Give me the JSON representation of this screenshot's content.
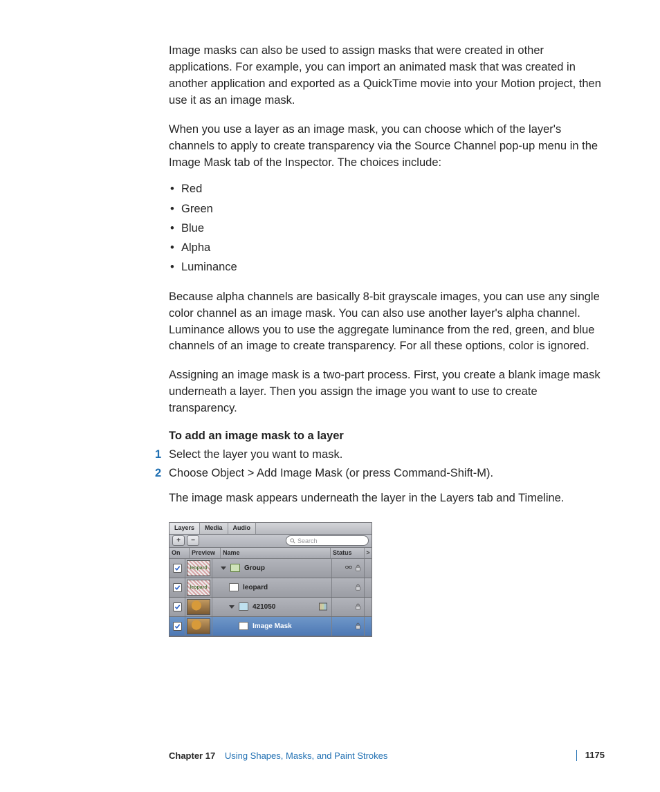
{
  "body": {
    "p1": "Image masks can also be used to assign masks that were created in other applications. For example, you can import an animated mask that was created in another application and exported as a QuickTime movie into your Motion project, then use it as an image mask.",
    "p2": "When you use a layer as an image mask, you can choose which of the layer's channels to apply to create transparency via the Source Channel pop-up menu in the Image Mask tab of the Inspector. The choices include:",
    "channels": [
      "Red",
      "Green",
      "Blue",
      "Alpha",
      "Luminance"
    ],
    "p3": "Because alpha channels are basically 8-bit grayscale images, you can use any single color channel as an image mask. You can also use another layer's alpha channel. Luminance allows you to use the aggregate luminance from the red, green, and blue channels of an image to create transparency. For all these options, color is ignored.",
    "p4": "Assigning an image mask is a two-part process. First, you create a blank image mask underneath a layer. Then you assign the image you want to use to create transparency.",
    "heading": "To add an image mask to a layer",
    "steps": [
      "Select the layer you want to mask.",
      "Choose Object > Add Image Mask (or press Command-Shift-M)."
    ],
    "after": "The image mask appears underneath the layer in the Layers tab and Timeline."
  },
  "panel": {
    "tabs": [
      "Layers",
      "Media",
      "Audio"
    ],
    "activeTab": 0,
    "plus": "+",
    "minus": "−",
    "searchPlaceholder": "Search",
    "columns": {
      "on": "On",
      "preview": "Preview",
      "name": "Name",
      "status": "Status",
      "expand": ">"
    },
    "rows": [
      {
        "name": "Group",
        "indent": 1,
        "thumb": "hatched",
        "thumbText": "leopard",
        "iconType": "group",
        "disclose": true,
        "selected": false,
        "status": [
          "link",
          "lock"
        ]
      },
      {
        "name": "leopard",
        "indent": 2,
        "thumb": "hatched",
        "thumbText": "leopard",
        "iconType": "text",
        "disclose": false,
        "selected": false,
        "status": [
          "lock"
        ]
      },
      {
        "name": "421050",
        "indent": 2,
        "thumb": "photo",
        "thumbText": "",
        "iconType": "img",
        "disclose": true,
        "selected": false,
        "status": [
          "lock"
        ],
        "badge": true
      },
      {
        "name": "Image Mask",
        "indent": 3,
        "thumb": "photo",
        "thumbText": "",
        "iconType": "mask",
        "disclose": false,
        "selected": true,
        "status": [
          "lock"
        ]
      }
    ]
  },
  "footer": {
    "chapter": "Chapter 17",
    "title": "Using Shapes, Masks, and Paint Strokes",
    "page": "1175"
  }
}
